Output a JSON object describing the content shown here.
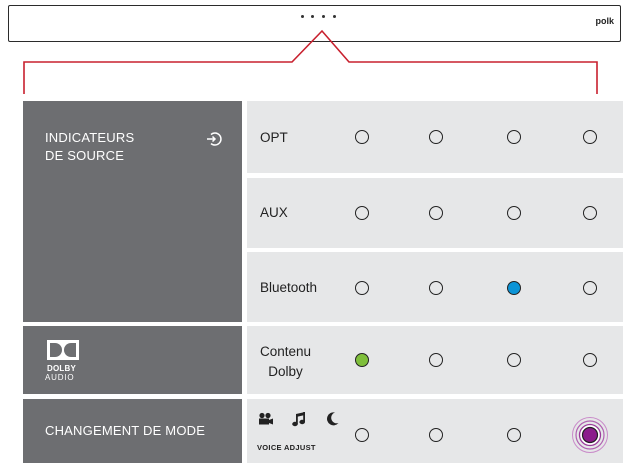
{
  "soundbar": {
    "brand": "polk",
    "indicator_dots": 4
  },
  "table": {
    "source_header": "INDICATEURS\nDE SOURCE",
    "source_icon": "input-arrow-icon",
    "sources": [
      {
        "label": "OPT",
        "lights": [
          "off",
          "off",
          "off",
          "off"
        ]
      },
      {
        "label": "AUX",
        "lights": [
          "off",
          "off",
          "off",
          "off"
        ]
      },
      {
        "label": "Bluetooth",
        "lights": [
          "off",
          "off",
          "blue",
          "off"
        ]
      }
    ],
    "dolby": {
      "logo_icon": "dolby-logo-icon",
      "logo_line1": "DOLBY",
      "logo_line2": "AUDIO",
      "label": "Contenu\nDolby",
      "lights": [
        "green",
        "off",
        "off",
        "off"
      ]
    },
    "mode": {
      "header": "CHANGEMENT DE MODE",
      "icons": [
        "movie-camera-icon",
        "music-note-icon",
        "moon-icon"
      ],
      "voice_adjust": "VOICE ADJUST",
      "lights": [
        "off",
        "off",
        "off",
        "purple-pulse"
      ]
    }
  },
  "colors": {
    "panel_dark": "#6d6e71",
    "panel_light": "#e6e7e8",
    "callout_red": "#c8202e",
    "blue": "#0c94d6",
    "green": "#7fbf3b",
    "purple": "#8b1c8c"
  }
}
